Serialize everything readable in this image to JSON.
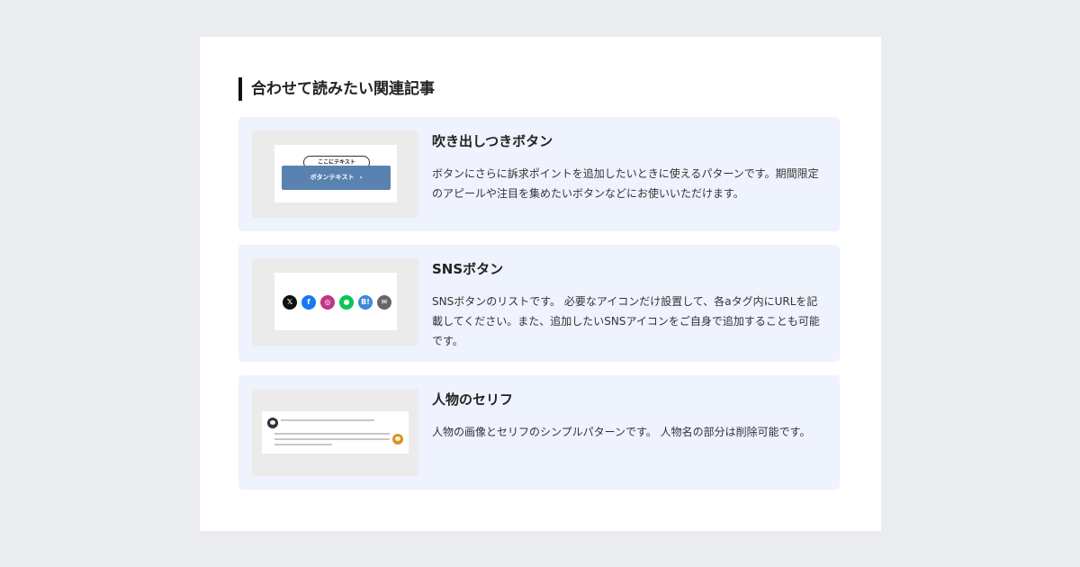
{
  "section": {
    "title": "合わせて読みたい関連記事"
  },
  "cards": [
    {
      "title": "吹き出しつきボタン",
      "description": "ボタンにさらに訴求ポイントを追加したいときに使えるパターンです。期間限定のアピールや注目を集めたいボタンなどにお使いいただけます。",
      "preview": {
        "bubble_text": "ここにテキスト",
        "button_text": "ボタンテキスト",
        "button_arrow": "›"
      }
    },
    {
      "title": "SNSボタン",
      "description": "SNSボタンのリストです。 必要なアイコンだけ設置して、各aタグ内にURLを記載してください。また、追加したいSNSアイコンをご自身で追加することも可能です。",
      "preview": {
        "icons": [
          {
            "name": "x-icon",
            "glyph": "𝕏",
            "color": "#111111"
          },
          {
            "name": "facebook-icon",
            "glyph": "f",
            "color": "#1877f2"
          },
          {
            "name": "instagram-icon",
            "glyph": "◎",
            "color": "#c13584"
          },
          {
            "name": "line-icon",
            "glyph": "●",
            "color": "#06c755"
          },
          {
            "name": "hatena-bookmark-icon",
            "glyph": "B!",
            "color": "#3d8ad8"
          },
          {
            "name": "mail-icon",
            "glyph": "✉",
            "color": "#666666"
          }
        ]
      }
    },
    {
      "title": "人物のセリフ",
      "description": "人物の画像とセリフのシンプルパターンです。 人物名の部分は削除可能です。"
    }
  ],
  "colors": {
    "page_bg": "#ebecef",
    "card_bg": "#eef3fd",
    "accent_button": "#5a82b0"
  }
}
